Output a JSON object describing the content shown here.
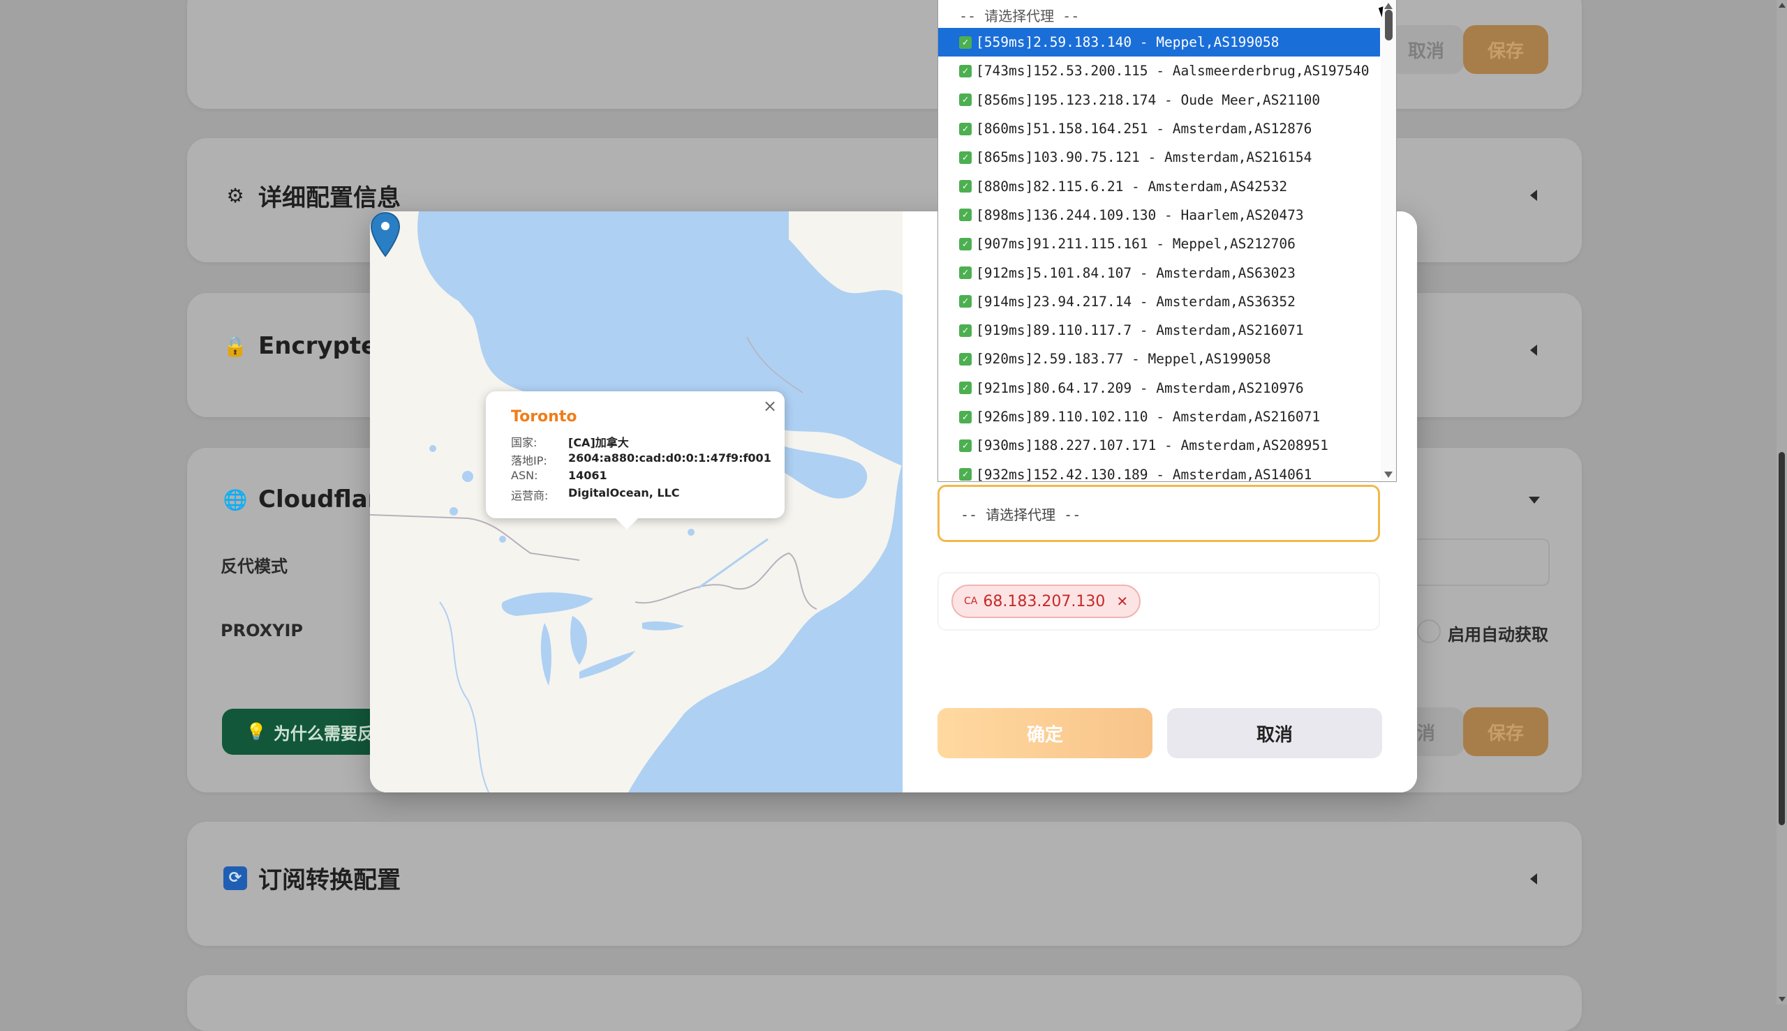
{
  "background": {
    "top_card": {
      "cancel_label": "取消",
      "save_label": "保存"
    },
    "detail_config": {
      "title": "详细配置信息",
      "icon": "gear-icon"
    },
    "encrypted": {
      "title": "Encrypted",
      "icon": "lock-icon"
    },
    "cloudflare": {
      "title": "Cloudflare",
      "icon": "globe-icon",
      "reverse_mode_label": "反代模式",
      "proxyip_label": "PROXYIP",
      "auto_fetch_label": "启用自动获取",
      "why_button_label": "为什么需要反",
      "cancel_label": "消",
      "save_label": "保存"
    },
    "subscription": {
      "title": "订阅转换配置",
      "icon": "refresh-icon"
    }
  },
  "modal": {
    "map_popup": {
      "city": "Toronto",
      "rows": [
        {
          "key": "国家:",
          "value": "[CA]加拿大"
        },
        {
          "key": "落地IP:",
          "value": "2604:a880:cad:d0:0:1:47f9:f001"
        },
        {
          "key": "ASN:",
          "value": "14061"
        },
        {
          "key": "运营商:",
          "value": "DigitalOcean, LLC"
        }
      ]
    },
    "select_placeholder": "-- 请选择代理 --",
    "selected_tag": {
      "country": "CA",
      "ip": "68.183.207.130"
    },
    "confirm_label": "确定",
    "cancel_label": "取消"
  },
  "dropdown": {
    "header": "-- 请选择代理 --",
    "items": [
      "[559ms]2.59.183.140 - Meppel,AS199058",
      "[743ms]152.53.200.115 - Aalsmeerderbrug,AS197540",
      "[856ms]195.123.218.174 - Oude Meer,AS21100",
      "[860ms]51.158.164.251 - Amsterdam,AS12876",
      "[865ms]103.90.75.121 - Amsterdam,AS216154",
      "[880ms]82.115.6.21 - Amsterdam,AS42532",
      "[898ms]136.244.109.130 - Haarlem,AS20473",
      "[907ms]91.211.115.161 - Meppel,AS212706",
      "[912ms]5.101.84.107 - Amsterdam,AS63023",
      "[914ms]23.94.217.14 - Amsterdam,AS36352",
      "[919ms]89.110.117.7 - Amsterdam,AS216071",
      "[920ms]2.59.183.77 - Meppel,AS199058",
      "[921ms]80.64.17.209 - Amsterdam,AS210976",
      "[926ms]89.110.102.110 - Amsterdam,AS216071",
      "[930ms]188.227.107.171 - Amsterdam,AS208951",
      "[932ms]152.42.130.189 - Amsterdam,AS14061"
    ],
    "selected_index": 0
  },
  "colors": {
    "accent_orange": "#f2b84b",
    "selected_blue": "#1a6ed8",
    "check_green": "#4caf50",
    "tag_red": "#c62828"
  }
}
